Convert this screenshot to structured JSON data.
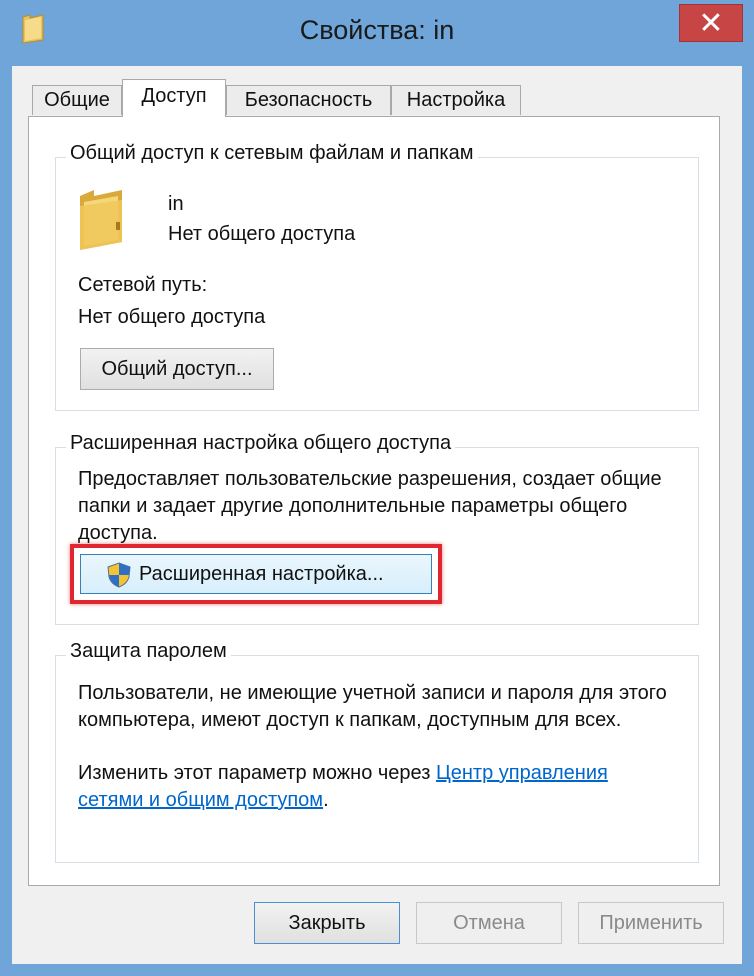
{
  "window": {
    "title": "Свойства: in",
    "close_symbol": "✕"
  },
  "tabs": [
    {
      "label": "Общие"
    },
    {
      "label": "Доступ"
    },
    {
      "label": "Безопасность"
    },
    {
      "label": "Настройка"
    }
  ],
  "network_sharing": {
    "legend": "Общий доступ к сетевым файлам и папкам",
    "folder_name": "in",
    "folder_status": "Нет общего доступа",
    "path_label": "Сетевой путь:",
    "path_value": "Нет общего доступа",
    "share_button": "Общий доступ..."
  },
  "advanced_sharing": {
    "legend": "Расширенная настройка общего доступа",
    "description": "Предоставляет пользовательские разрешения, создает общие папки и задает другие дополнительные параметры общего доступа.",
    "button": "Расширенная настройка..."
  },
  "password_protection": {
    "legend": "Защита паролем",
    "description": "Пользователи, не имеющие учетной записи и пароля для этого компьютера, имеют доступ к папкам, доступным для всех.",
    "change_text": "Изменить этот параметр можно через ",
    "link_text": "Центр управления сетями и общим доступом",
    "trailing": "."
  },
  "footer": {
    "close_button": "Закрыть",
    "cancel_button": "Отмена",
    "apply_button": "Применить"
  },
  "icons": [
    "folder-icon",
    "close-icon",
    "uac-shield-icon"
  ],
  "colors": {
    "title_bar": "#6fa5d8",
    "close": "#c74545",
    "highlight": "#e0262f",
    "link": "#0066cc"
  }
}
